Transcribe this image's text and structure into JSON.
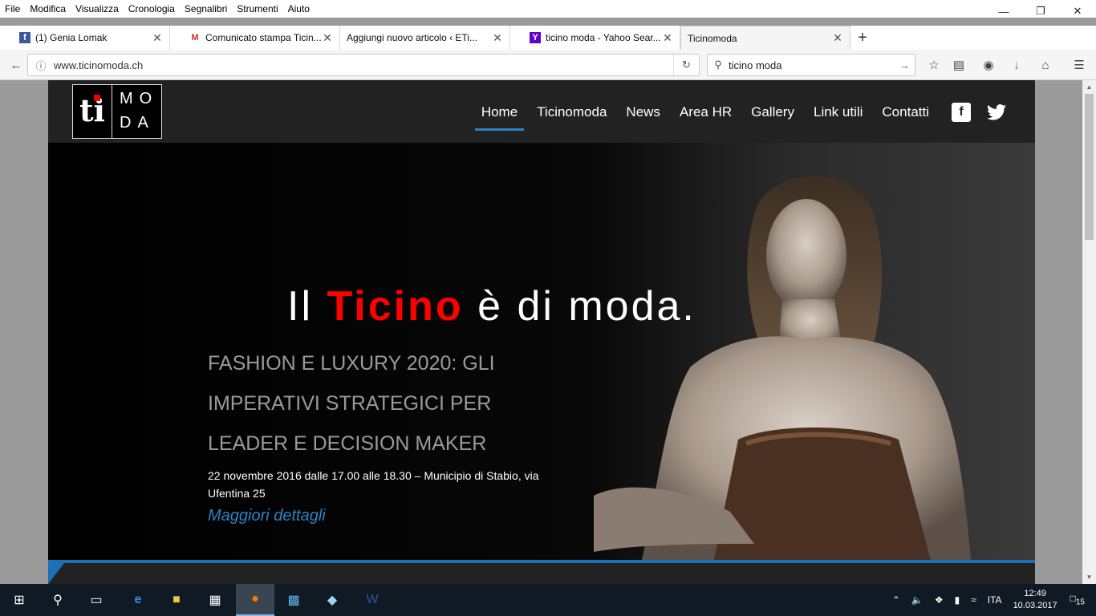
{
  "menubar": {
    "items": [
      "File",
      "Modifica",
      "Visualizza",
      "Cronologia",
      "Segnalibri",
      "Strumenti",
      "Aiuto"
    ]
  },
  "tabs": [
    {
      "title": "(1) Genia Lomak",
      "icon": "facebook-icon",
      "color": "#3b5998"
    },
    {
      "title": "Comunicato stampa Ticin...",
      "icon": "gmail-icon",
      "color": "#d93025"
    },
    {
      "title": "Aggiungi nuovo articolo ‹ ETi...",
      "icon": "",
      "color": ""
    },
    {
      "title": "ticino moda - Yahoo Sear...",
      "icon": "yahoo-icon",
      "color": "#6001d2"
    },
    {
      "title": "Ticinomoda",
      "icon": "",
      "color": ""
    }
  ],
  "urlbar": {
    "url": "www.ticinomoda.ch"
  },
  "searchbar": {
    "query": "ticino moda"
  },
  "site": {
    "logo": {
      "left": "ti",
      "right_top": "MO",
      "right_bottom": "DA"
    },
    "nav": [
      "Home",
      "Ticinomoda",
      "News",
      "Area HR",
      "Gallery",
      "Link utili",
      "Contatti"
    ],
    "headline": {
      "part1": "Il ",
      "highlight": "Ticino",
      "part2": " è di moda."
    },
    "event": {
      "title": "FASHION E LUXURY 2020: GLI IMPERATIVI STRATEGICI PER LEADER E DECISION MAKER",
      "desc": "22 novembre 2016 dalle 17.00 alle 18.30 – Municipio di Stabio, via Ufentina 25",
      "link": "Maggiori dettagli"
    },
    "colors": {
      "accent_blue": "#2a83c4",
      "headline_red": "#ff0000"
    }
  },
  "taskbar": {
    "lang": "ITA",
    "time": "12:49",
    "date": "10.03.2017",
    "notifications": "15"
  }
}
